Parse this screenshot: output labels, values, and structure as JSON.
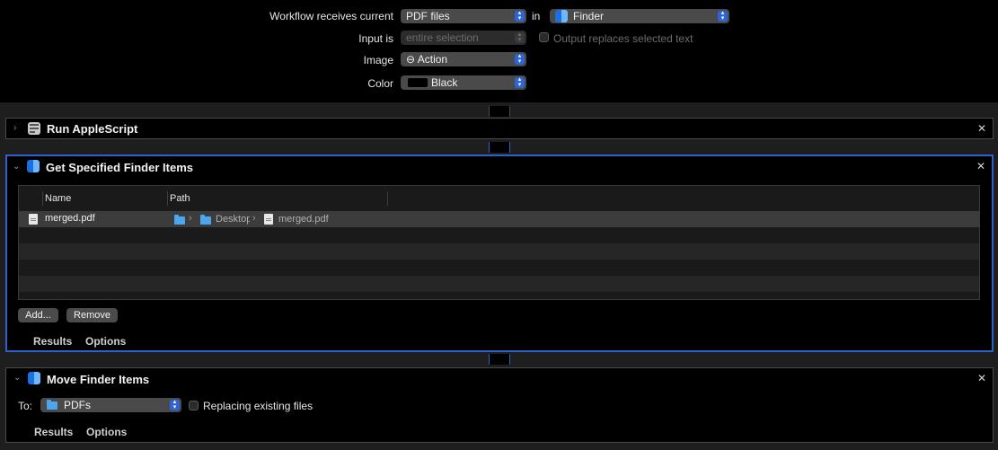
{
  "workflow": {
    "receives_label": "Workflow receives current",
    "input_type": "PDF files",
    "in_label": "in",
    "application": "Finder",
    "input_is_label": "Input is",
    "input_is_value": "entire selection",
    "output_replaces_label": "Output replaces selected text",
    "image_label": "Image",
    "image_value": "⊖ Action",
    "color_label": "Color",
    "color_value": "Black",
    "color_swatch": "#000000"
  },
  "actions": {
    "run_applescript": {
      "title": "Run AppleScript",
      "expanded": false
    },
    "get_finder_items": {
      "title": "Get Specified Finder Items",
      "columns": {
        "name": "Name",
        "path": "Path"
      },
      "rows": [
        {
          "name": "merged.pdf",
          "path_folder": "Desktop",
          "path_file": "merged.pdf"
        }
      ],
      "add_label": "Add...",
      "remove_label": "Remove",
      "results_tab": "Results",
      "options_tab": "Options"
    },
    "move_finder_items": {
      "title": "Move Finder Items",
      "to_label": "To:",
      "to_value": "PDFs",
      "replacing_label": "Replacing existing files",
      "results_tab": "Results",
      "options_tab": "Options"
    }
  },
  "icons": {
    "expand": "›",
    "collapse": "⌄",
    "close": "✕",
    "path_sep": "›",
    "stepper": "⌃⌄"
  },
  "colors": {
    "accent": "#2f64d6",
    "selected_border": "#2e62c9",
    "background": "#000000"
  }
}
